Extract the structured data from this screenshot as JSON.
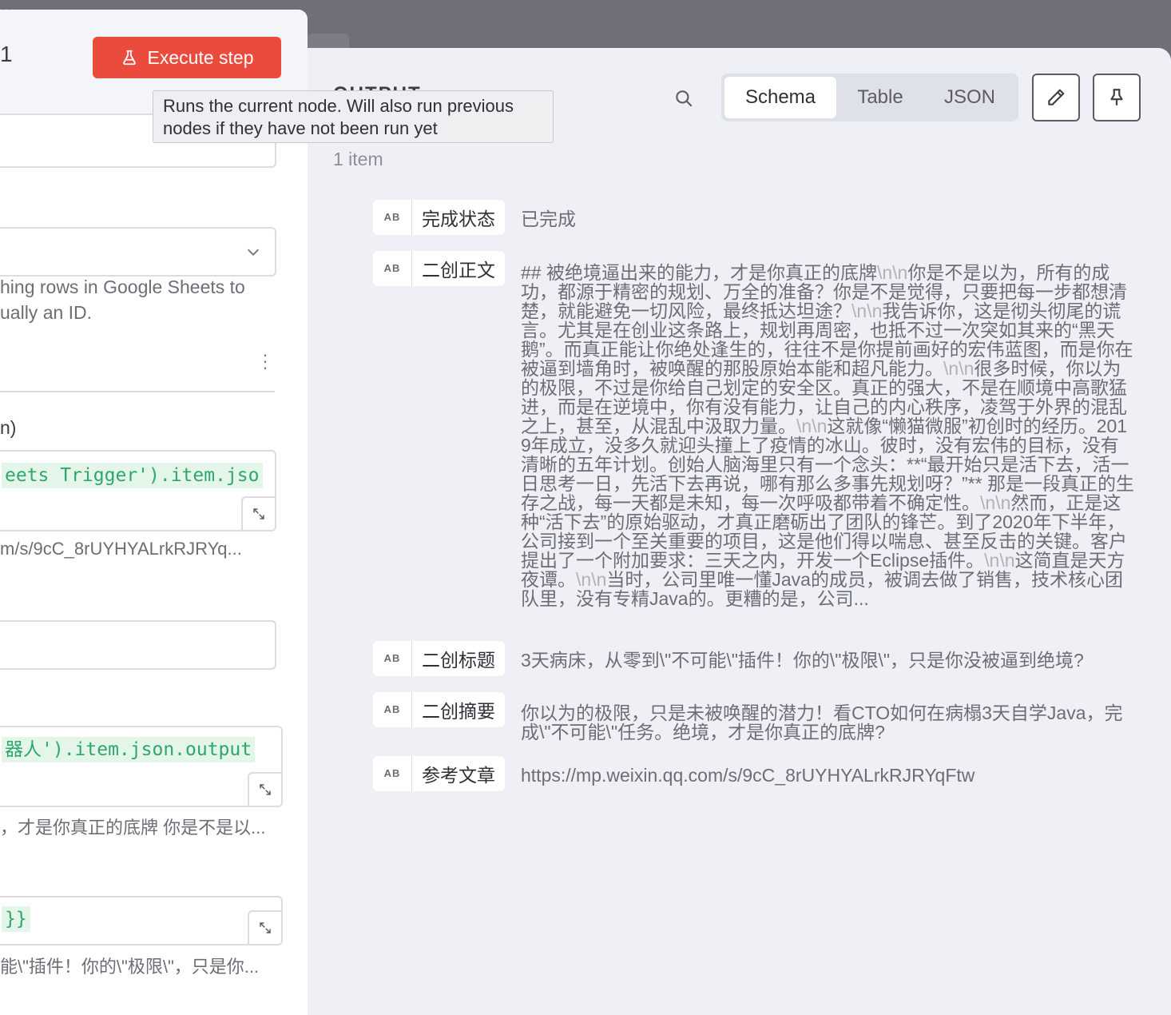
{
  "left_panel": {
    "node_title_fragment": "1",
    "execute_button_label": "Execute step",
    "hint_lines": [
      "hing rows in Google Sheets to",
      "ually an ID."
    ],
    "paren_text": "n)",
    "expr1_code": "eets Trigger').item.jso",
    "expr1_result": "m/s/9cC_8rUYHYALrkRJRYq...",
    "expr2_code": "器人').item.json.output",
    "expr2_result": "，才是你真正的底牌 你是不是以...",
    "expr3_code": "}}",
    "expr3_result": "能\\\"插件！你的\\\"极限\\\"，只是你..."
  },
  "tooltip": {
    "text": "Runs the current node. Will also run previous nodes if they have not been run yet"
  },
  "output": {
    "title": "OUTPUT",
    "tabs": [
      "Schema",
      "Table",
      "JSON"
    ],
    "active_tab": "Schema",
    "item_count": "1 item",
    "type_badge": "AB",
    "rows": [
      {
        "key": "完成状态",
        "value": "已完成"
      },
      {
        "key": "二创正文",
        "value_parts": [
          "## 被绝境逼出来的能力，才是你真正的底牌",
          "\\n\\n",
          "你是不是以为，所有的成功，都源于精密的规划、万全的准备？你是不是觉得，只要把每一步都想清楚，就能避免一切风险，最终抵达坦途？",
          "\\n\\n",
          "我告诉你，这是彻头彻尾的谎言。尤其是在创业这条路上，规划再周密，也抵不过一次突如其来的“黑天鹅”。而真正能让你绝处逢生的，往往不是你提前画好的宏伟蓝图，而是你在被逼到墙角时，被唤醒的那股原始本能和超凡能力。",
          "\\n\\n",
          "很多时候，你以为的极限，不过是你给自己划定的安全区。真正的强大，不是在顺境中高歌猛进，而是在逆境中，你有没有能力，让自己的内心秩序，凌驾于外界的混乱之上，甚至，从混乱中汲取力量。",
          "\\n\\n",
          "这就像“懒猫微服”初创时的经历。2019年成立，没多久就迎头撞上了疫情的冰山。彼时，没有宏伟的目标，没有清晰的五年计划。创始人脑海里只有一个念头：**“最开始只是活下去，活一日思考一日，先活下去再说，哪有那么多事先规划呀？”** 那是一段真正的生存之战，每一天都是未知，每一次呼吸都带着不确定性。",
          "\\n\\n",
          "然而，正是这种“活下去”的原始驱动，才真正磨砺出了团队的锋芒。到了2020年下半年，公司接到一个至关重要的项目，这是他们得以喘息、甚至反击的关键。客户提出了一个附加要求：三天之内，开发一个Eclipse插件。",
          "\\n\\n",
          "这简直是天方夜谭。",
          "\\n\\n",
          "当时，公司里唯一懂Java的成员，被调去做了销售，技术核心团队里，没有专精Java的。更糟的是，公司..."
        ]
      },
      {
        "key": "二创标题",
        "value": "3天病床，从零到\\\"不可能\\\"插件！你的\\\"极限\\\"，只是你没被逼到绝境?"
      },
      {
        "key": "二创摘要",
        "value": "你以为的极限，只是未被唤醒的潜力！看CTO如何在病榻3天自学Java，完成\\\"不可能\\\"任务。绝境，才是你真正的底牌?"
      },
      {
        "key": "参考文章",
        "value": "https://mp.weixin.qq.com/s/9cC_8rUYHYALrkRJRYqFtw"
      }
    ]
  },
  "colors": {
    "execute_button": "#ea4b3c",
    "panel_bg": "#eef0f6",
    "expression_green": "#2fa66a",
    "expression_bg": "#e4f6ea"
  },
  "icons": [
    "flask-icon",
    "search-icon",
    "pencil-icon",
    "pin-icon",
    "chevron-down-icon",
    "expand-icon",
    "drag-handle-icon",
    "kebab-menu-icon"
  ]
}
